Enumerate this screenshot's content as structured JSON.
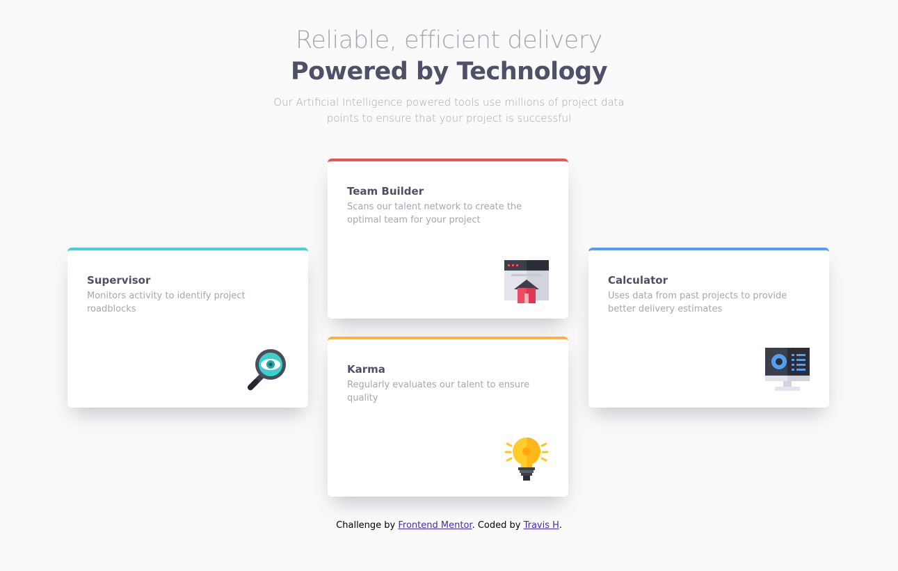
{
  "header": {
    "subtitle": "Reliable, efficient delivery",
    "title": "Powered by Technology",
    "intro_line1": "Our Artificial Intelligence powered tools use millions of project data",
    "intro_line2": "points to ensure that your project is successful"
  },
  "cards": {
    "supervisor": {
      "title": "Supervisor",
      "desc": "Monitors activity to identify project roadblocks",
      "icon": "magnifier-eye-icon",
      "accent": "#44d3d2"
    },
    "team_builder": {
      "title": "Team Builder",
      "desc": "Scans our talent network to create the optimal team for your project",
      "icon": "browser-home-icon",
      "accent": "#ea5454"
    },
    "karma": {
      "title": "Karma",
      "desc": "Regularly evaluates our talent to ensure quality",
      "icon": "lightbulb-icon",
      "accent": "#fcaf4a"
    },
    "calculator": {
      "title": "Calculator",
      "desc": "Uses data from past projects to provide better delivery estimates",
      "icon": "monitor-dashboard-icon",
      "accent": "#549ef2"
    }
  },
  "attribution": {
    "prefix": "Challenge by ",
    "link1": "Frontend Mentor",
    "middle": ". Coded by ",
    "link2": "Travis H",
    "suffix": "."
  }
}
